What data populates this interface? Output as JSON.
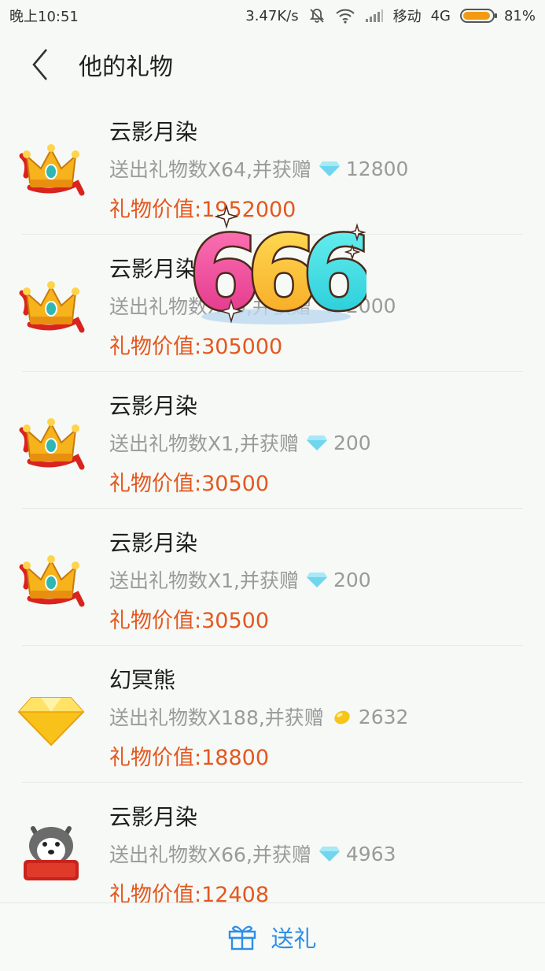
{
  "status_bar": {
    "time": "晚上10:51",
    "speed": "3.47K/s",
    "carrier": "移动",
    "network": "4G",
    "battery": "81%",
    "battery_level": 0.81
  },
  "header": {
    "title": "他的礼物"
  },
  "gifts": [
    {
      "name": "云影月染",
      "count_text": "送出礼物数X64,并获赠",
      "reward_icon": "diamond-icon",
      "reward": "12800",
      "value_label": "礼物价值:",
      "value": "1952000",
      "gift_icon": "crown-icon"
    },
    {
      "name": "云影月染",
      "count_text": "送出礼物数X10,并获赠",
      "reward_icon": "diamond-icon",
      "reward": "2000",
      "value_label": "礼物价值:",
      "value": "305000",
      "gift_icon": "crown-icon"
    },
    {
      "name": "云影月染",
      "count_text": "送出礼物数X1,并获赠",
      "reward_icon": "diamond-icon",
      "reward": "200",
      "value_label": "礼物价值:",
      "value": "30500",
      "gift_icon": "crown-icon"
    },
    {
      "name": "云影月染",
      "count_text": "送出礼物数X1,并获赠",
      "reward_icon": "diamond-icon",
      "reward": "200",
      "value_label": "礼物价值:",
      "value": "30500",
      "gift_icon": "crown-icon"
    },
    {
      "name": "幻冥熊",
      "count_text": "送出礼物数X188,并获赠",
      "reward_icon": "gold-bean-icon",
      "reward": "2632",
      "value_label": "礼物价值:",
      "value": "18800",
      "gift_icon": "yellow-diamond-icon"
    },
    {
      "name": "云影月染",
      "count_text": "送出礼物数X66,并获赠",
      "reward_icon": "diamond-icon",
      "reward": "4963",
      "value_label": "礼物价值:",
      "value": "12408",
      "gift_icon": "husky-new-year-icon"
    }
  ],
  "sticker": {
    "text": "666"
  },
  "bottom_bar": {
    "send_label": "送礼"
  },
  "colors": {
    "accent": "#2f8ee6",
    "value_red": "#e4571f",
    "sub_gray": "#9a9a9a"
  }
}
